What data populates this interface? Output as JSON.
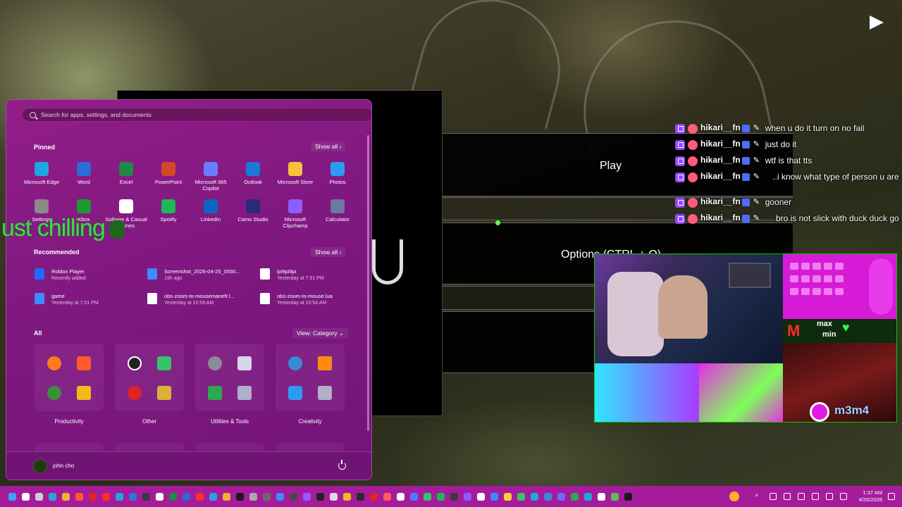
{
  "start_menu": {
    "search_placeholder": "Search for apps, settings, and documents",
    "pinned_title": "Pinned",
    "pinned_show_all": "Show all",
    "pinned": [
      {
        "label": "Microsoft Edge",
        "icon": "edge-icon",
        "color": "#1fa8e0"
      },
      {
        "label": "Word",
        "icon": "word-icon",
        "color": "#2b6cd6"
      },
      {
        "label": "Excel",
        "icon": "excel-icon",
        "color": "#1d8a47"
      },
      {
        "label": "PowerPoint",
        "icon": "powerpoint-icon",
        "color": "#d5482b"
      },
      {
        "label": "Microsoft 365 Copilot",
        "icon": "m365-icon",
        "color": "#6b7dff"
      },
      {
        "label": "Outlook",
        "icon": "outlook-icon",
        "color": "#1a7ad4"
      },
      {
        "label": "Microsoft Store",
        "icon": "store-icon",
        "color": "#f3c13a"
      },
      {
        "label": "Photos",
        "icon": "photos-icon",
        "color": "#2e9bf0"
      },
      {
        "label": "Settings",
        "icon": "settings-icon",
        "color": "#8a8a8a"
      },
      {
        "label": "Xbox",
        "icon": "xbox-icon",
        "color": "#1c9a2e"
      },
      {
        "label": "Solitaire & Casual Games",
        "icon": "solitaire-icon",
        "color": "#ffffff"
      },
      {
        "label": "Spotify",
        "icon": "spotify-icon",
        "color": "#1db954"
      },
      {
        "label": "LinkedIn",
        "icon": "linkedin-icon",
        "color": "#0a66c2"
      },
      {
        "label": "Camo Studio",
        "icon": "camo-icon",
        "color": "#2a2a7a"
      },
      {
        "label": "Microsoft Clipchamp",
        "icon": "clipchamp-icon",
        "color": "#8e5cff"
      },
      {
        "label": "Calculator",
        "icon": "calculator-icon",
        "color": "#6a7aa0"
      }
    ],
    "recommended_title": "Recommended",
    "recommended_show_all": "Show all",
    "recommended": [
      {
        "name": "Roblox Player",
        "time": "Recently added",
        "color": "#1e6cff"
      },
      {
        "name": "Screenshot_2026-04-25_0550...",
        "time": "19h ago",
        "color": "#3a8cff"
      },
      {
        "name": "ipi9pi9pi",
        "time": "Yesterday at 7:51 PM",
        "color": "#ffffff"
      },
      {
        "name": "game",
        "time": "Yesterday at 7:51 PM",
        "color": "#3a8cff"
      },
      {
        "name": "obs-zoom-to-mousemanefr.l...",
        "time": "Yesterday at 10:59 AM",
        "color": "#ffffff"
      },
      {
        "name": "obs-zoom-to-mouse.lua",
        "time": "Yesterday at 10:54 AM",
        "color": "#ffffff"
      }
    ],
    "all_title": "All",
    "view_label": "View: Category",
    "categories": [
      {
        "label": "Productivity"
      },
      {
        "label": "Other"
      },
      {
        "label": "Utilities & Tools"
      },
      {
        "label": "Creativity"
      }
    ],
    "user_name": "john cho"
  },
  "overlay": {
    "chill_text": "ust chilling"
  },
  "game": {
    "play_label": "Play",
    "options_label": "Options (CTRL + O)"
  },
  "chat": [
    {
      "user": "hikari__fn",
      "text": "when u do it turn on no fail"
    },
    {
      "user": "hikari__fn",
      "text": "just do it"
    },
    {
      "user": "hikari__fn",
      "text": "wtf is that tts"
    },
    {
      "user": "hikari__fn",
      "text": "i know what type of person u are.."
    },
    {
      "user": "hikari__fn",
      "text": "gooner"
    },
    {
      "user": "hikari__fn",
      "text": "bro is not slick with duck duck go"
    }
  ],
  "webcam": {
    "max_label": "max",
    "min_label": "min",
    "m3m4_label": "m3m4"
  },
  "taskbar": {
    "time": "1:37 AM",
    "date": "4/26/2026"
  },
  "colors": {
    "start_bg": "#84197f",
    "taskbar_bg": "#a41c9a",
    "accent_green": "#38e33a",
    "twitch_purple": "#9146ff"
  }
}
